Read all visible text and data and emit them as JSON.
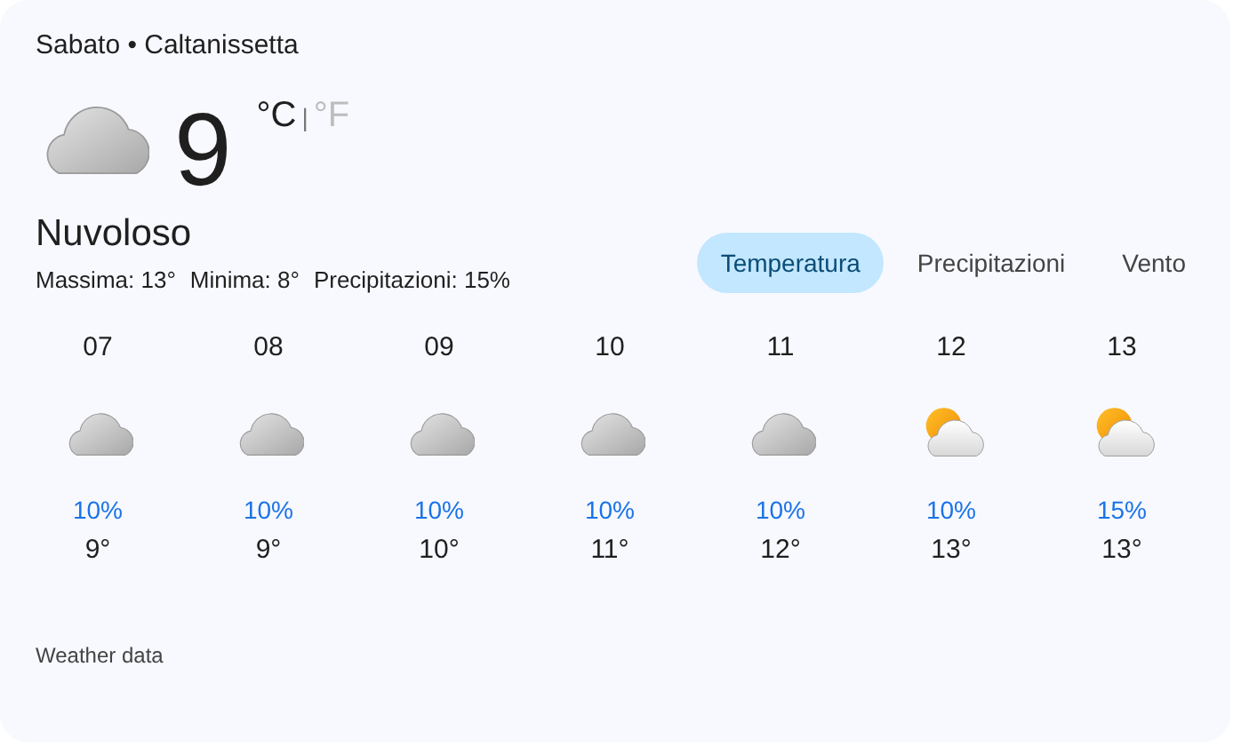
{
  "header": {
    "title": "Sabato • Caltanissetta"
  },
  "current": {
    "kind": "cloudy",
    "temperature": "9",
    "units": [
      {
        "label": "°C",
        "selected": true
      },
      {
        "label": "°F",
        "selected": false
      }
    ],
    "separator": "|",
    "condition": "Nuvoloso",
    "details": [
      "Massima: 13°",
      "Minima: 8°",
      "Precipitazioni: 15%"
    ]
  },
  "tabs": [
    {
      "label": "Temperatura",
      "selected": true
    },
    {
      "label": "Precipitazioni",
      "selected": false
    },
    {
      "label": "Vento",
      "selected": false
    }
  ],
  "hours": [
    {
      "hour": "07",
      "kind": "cloudy",
      "precipitation": "10%",
      "temperature": "9°"
    },
    {
      "hour": "08",
      "kind": "cloudy",
      "precipitation": "10%",
      "temperature": "9°"
    },
    {
      "hour": "09",
      "kind": "cloudy",
      "precipitation": "10%",
      "temperature": "10°"
    },
    {
      "hour": "10",
      "kind": "cloudy",
      "precipitation": "10%",
      "temperature": "11°"
    },
    {
      "hour": "11",
      "kind": "cloudy",
      "precipitation": "10%",
      "temperature": "12°"
    },
    {
      "hour": "12",
      "kind": "partly_cloudy",
      "precipitation": "10%",
      "temperature": "13°"
    },
    {
      "hour": "13",
      "kind": "partly_cloudy",
      "precipitation": "15%",
      "temperature": "13°"
    }
  ],
  "footer": "Weather data"
}
